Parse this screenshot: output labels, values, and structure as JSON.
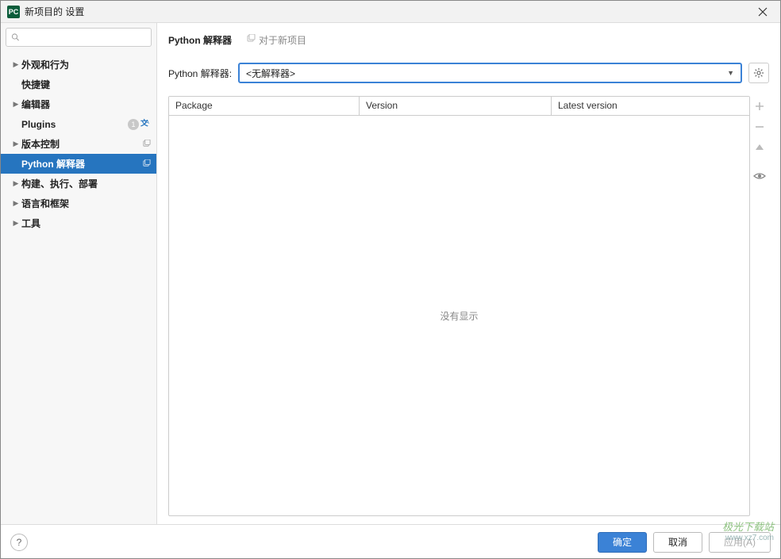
{
  "window": {
    "title": "新项目的 设置",
    "app_icon_text": "PC"
  },
  "search": {
    "placeholder": ""
  },
  "sidebar": {
    "items": [
      {
        "label": "外观和行为",
        "expandable": true,
        "bold": true
      },
      {
        "label": "快捷键",
        "expandable": false,
        "bold": true
      },
      {
        "label": "编辑器",
        "expandable": true,
        "bold": true
      },
      {
        "label": "Plugins",
        "expandable": false,
        "bold": true,
        "badge": "1",
        "trans": true
      },
      {
        "label": "版本控制",
        "expandable": true,
        "bold": true,
        "copy": true
      },
      {
        "label": "Python 解释器",
        "expandable": false,
        "bold": true,
        "selected": true,
        "copy": true
      },
      {
        "label": "构建、执行、部署",
        "expandable": true,
        "bold": true
      },
      {
        "label": "语言和框架",
        "expandable": true,
        "bold": true
      },
      {
        "label": "工具",
        "expandable": true,
        "bold": true
      }
    ]
  },
  "breadcrumb": {
    "main": "Python 解释器",
    "sub": "对于新项目"
  },
  "interpreter": {
    "label": "Python 解释器:",
    "value": "<无解释器>"
  },
  "table": {
    "headers": {
      "package": "Package",
      "version": "Version",
      "latest": "Latest version"
    },
    "empty_text": "没有显示"
  },
  "buttons": {
    "ok": "确定",
    "cancel": "取消",
    "apply": "应用(A)"
  },
  "watermark": {
    "line1": "极光下载站",
    "line2": "www.xz7.com"
  }
}
